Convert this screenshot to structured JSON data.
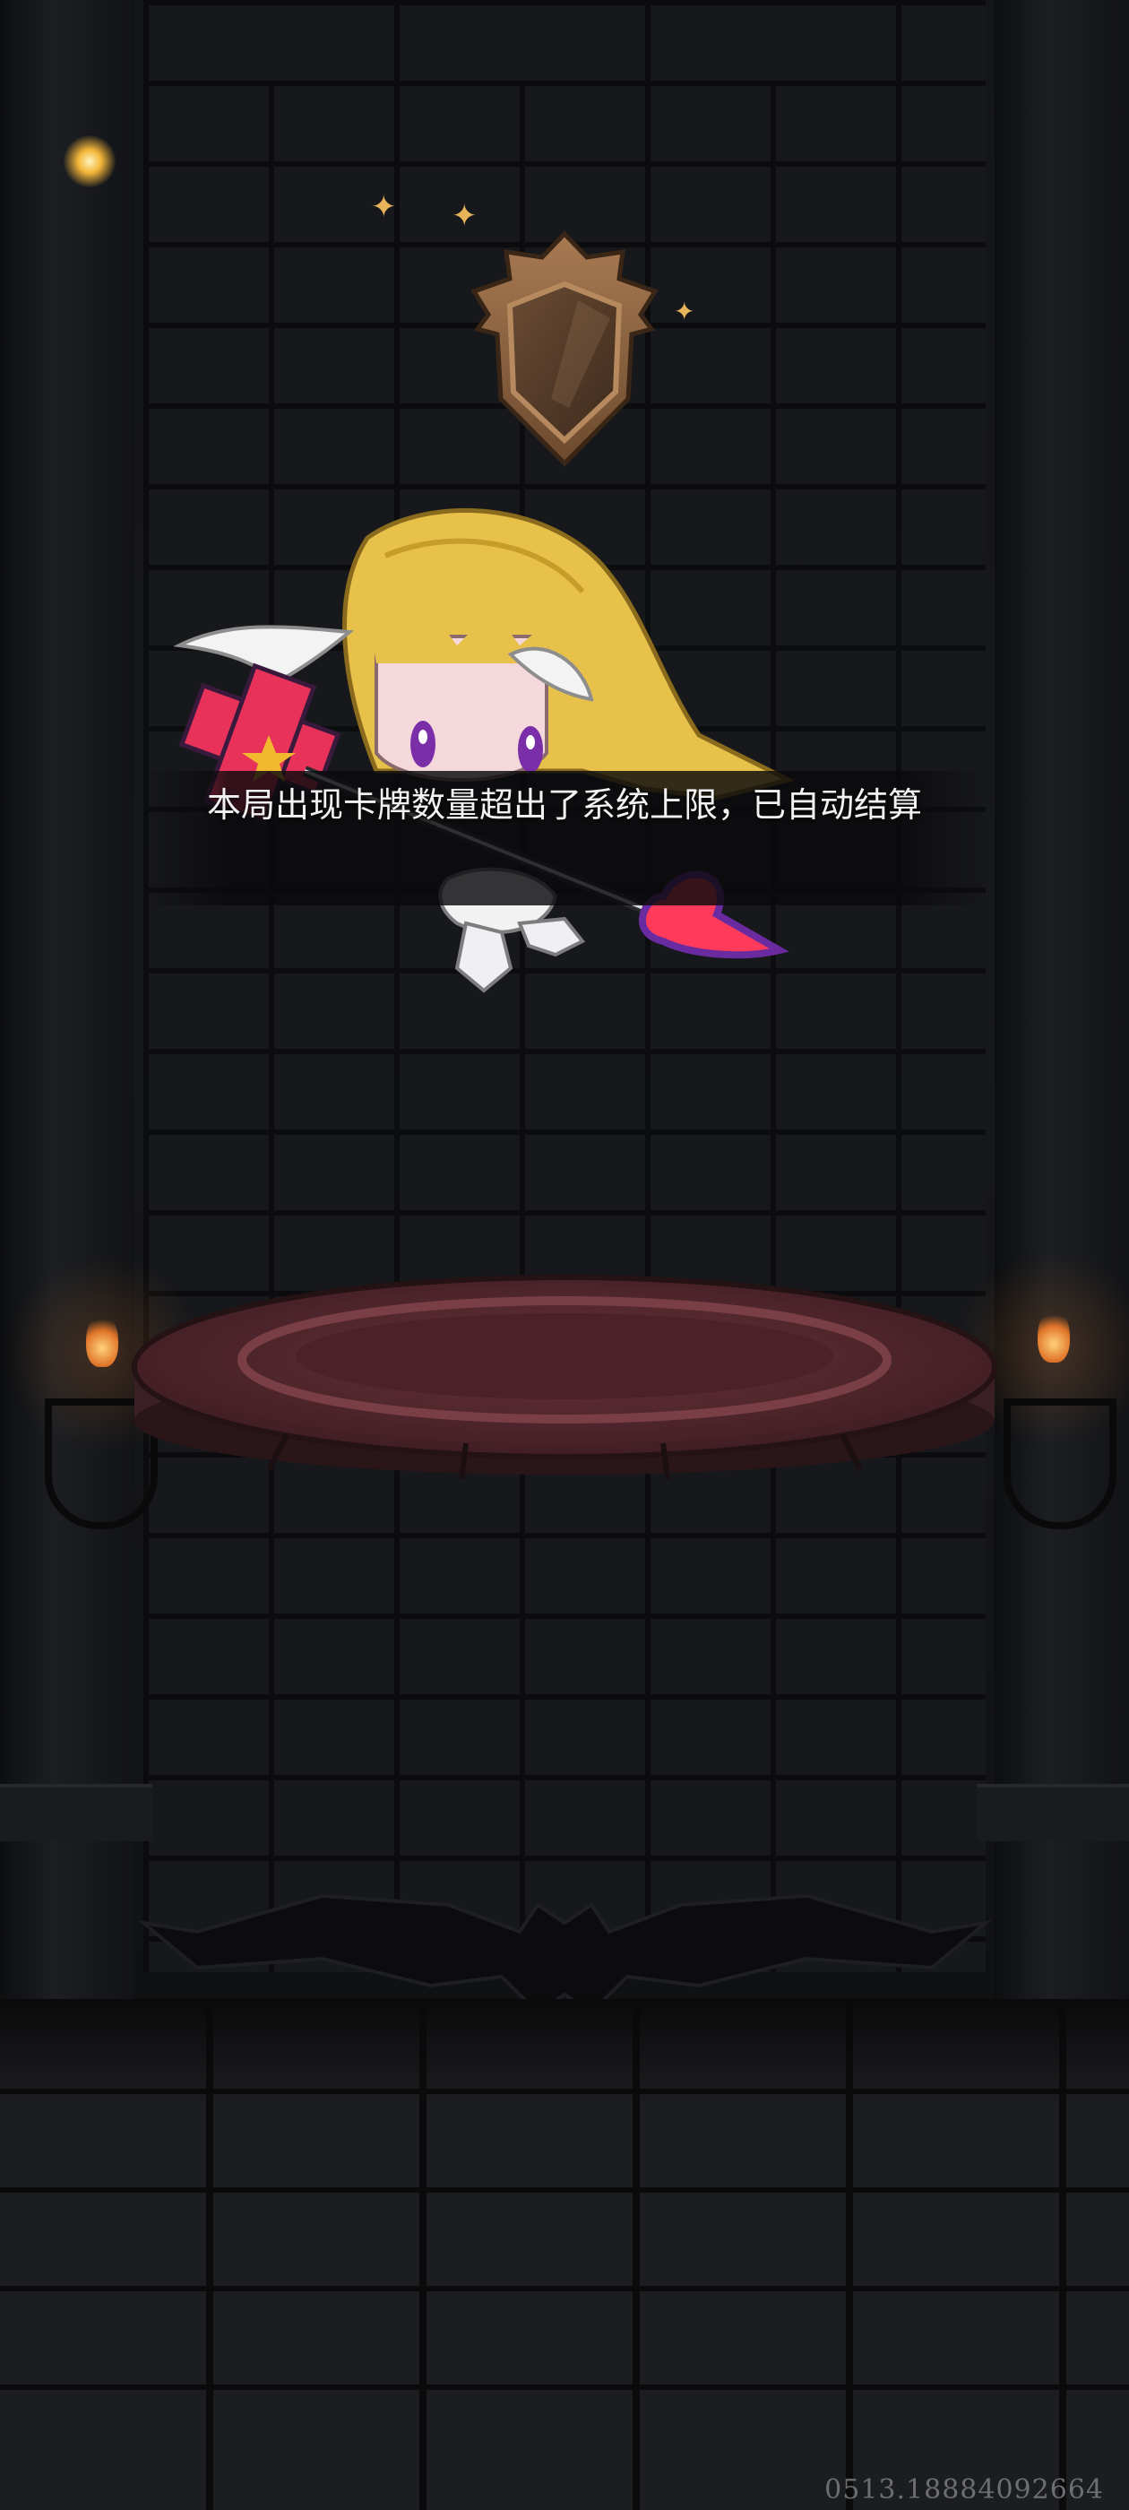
{
  "notice": {
    "message": "本局出现卡牌数量超出了系统上限，已自动结算"
  },
  "watermark": {
    "text": "0513.18884092664"
  },
  "colors": {
    "background": "#141517",
    "notice_text": "#f2f2f2",
    "notice_banner": "#0a0a0c",
    "pedestal_top": "#5a2c30",
    "shield": "#8a6240",
    "sparkle": "#e8b45a",
    "torch_flame": "#e0762a"
  },
  "icons": {
    "shield": "shield-emblem-icon",
    "sparkle": "sparkle-icon",
    "torch": "torch-flame-icon",
    "bat": "bat-ornament-icon"
  }
}
